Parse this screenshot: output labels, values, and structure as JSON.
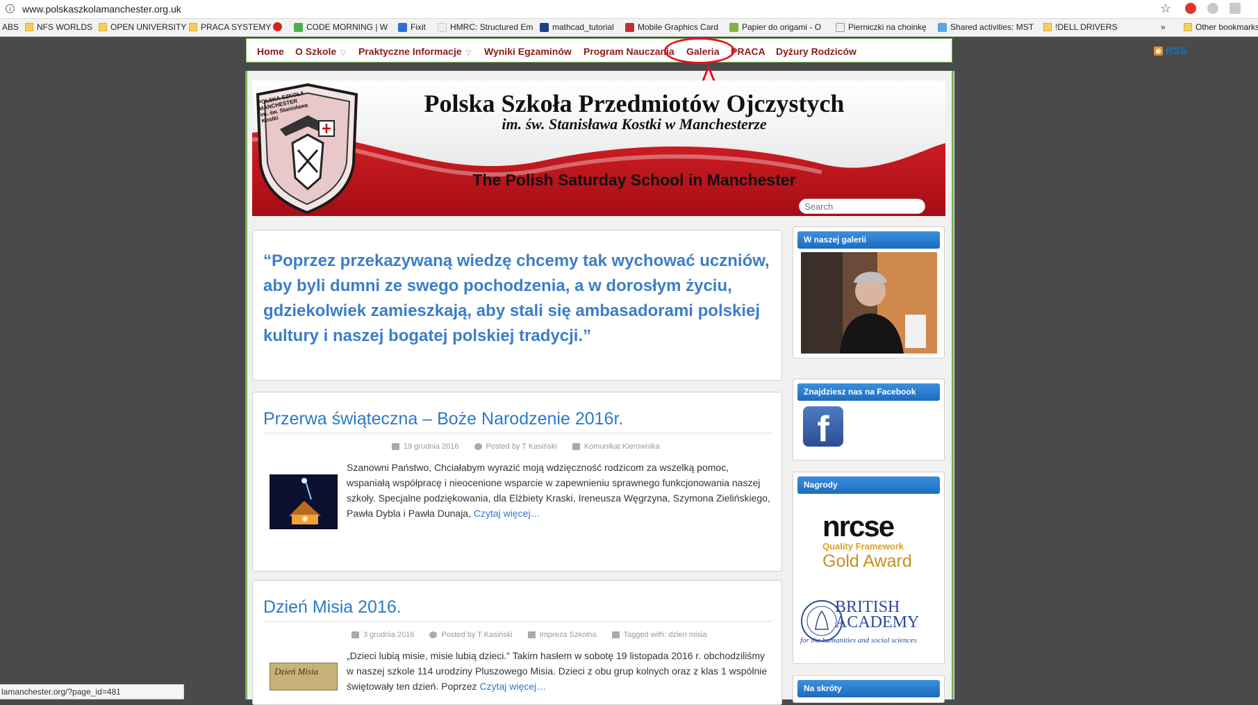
{
  "browser": {
    "url": "www.polskaszkolamanchester.org.uk",
    "bookmarks": [
      {
        "label": "ABS",
        "kind": "none"
      },
      {
        "label": "NFS WORLDS",
        "kind": "folder"
      },
      {
        "label": "OPEN UNIVERSITY",
        "kind": "folder"
      },
      {
        "label": "PRACA SYSTEMY",
        "kind": "folder"
      },
      {
        "label": "",
        "kind": "opera"
      },
      {
        "label": "CODE MORNING | W",
        "kind": "page"
      },
      {
        "label": "Fixit",
        "kind": "page"
      },
      {
        "label": "HMRC: Structured Em",
        "kind": "page"
      },
      {
        "label": "mathcad_tutorial",
        "kind": "page"
      },
      {
        "label": "Mobile Graphics Card",
        "kind": "page"
      },
      {
        "label": "Papier do origami - O",
        "kind": "page"
      },
      {
        "label": "Pierniczki na choinkę",
        "kind": "page"
      },
      {
        "label": "Shared activities: MST",
        "kind": "page"
      },
      {
        "label": "!DELL DRIVERS",
        "kind": "folder"
      }
    ],
    "bookmarks_overflow": "»",
    "other_bookmarks": "Other bookmarks",
    "status_url": "lamanchester.org/?page_id=481"
  },
  "nav": {
    "items": [
      {
        "label": "Home",
        "dropdown": false
      },
      {
        "label": "O Szkole",
        "dropdown": true
      },
      {
        "label": "Praktyczne Informacje",
        "dropdown": true
      },
      {
        "label": "Wyniki Egzaminów",
        "dropdown": false
      },
      {
        "label": "Program Nauczania",
        "dropdown": false
      },
      {
        "label": "Galeria",
        "dropdown": false
      },
      {
        "label": "PRACA",
        "dropdown": false
      },
      {
        "label": "Dyżury Rodziców",
        "dropdown": false
      }
    ],
    "rss": "RSS"
  },
  "banner": {
    "title": "Polska Szkoła Przedmiotów Ojczystych",
    "subtitle": "im. św. Stanisława Kostki w Manchesterze",
    "english": "The Polish Saturday School in Manchester",
    "crest_text": "POLSKA SZKOŁA MANCHESTER im. św. Stanisława Kostki"
  },
  "search": {
    "placeholder": "Search"
  },
  "quote": {
    "text": "“Poprzez przekazywaną wiedzę chcemy tak wychować uczniów, aby byli dumni ze swego pochodzenia, a w dorosłym życiu, gdziekolwiek zamieszkają, aby stali się ambasadorami polskiej kultury i naszej bogatej polskiej tradycji.”"
  },
  "posts": [
    {
      "title": "Przerwa świąteczna – Boże Narodzenie 2016r.",
      "date": "19 grudnia 2016",
      "author": "Posted by T Kasiński",
      "category": "Komunikat Kierownika",
      "tags": "",
      "excerpt": "Szanowni Państwo, Chciałabym wyrazić moją wdzięczność rodzicom za wszelką pomoc, wspaniałą współpracę i nieocenione wsparcie w zapewnieniu sprawnego funkcjonowania naszej szkoły. Specjalne podziękowania, dla Elżbiety Kraski, Ireneusza Węgrzyna, Szymona Zielińskiego, Pawła Dybla i Pawła Dunaja,",
      "more": "Czytaj więcej…"
    },
    {
      "title": "Dzień Misia 2016.",
      "date": "3 grudnia 2016",
      "author": "Posted by T Kasiński",
      "category": "Impreza Szkolna",
      "tags": "Tagged with: dzien misia",
      "excerpt": "„Dzieci lubią misie, misie lubią dzieci.”   Takim hasłem w sobotę 19 listopada 2016 r. obchodziliśmy w naszej szkole 114 urodziny Pluszowego Misia. Dzieci z obu grup kolnych oraz z klas 1 wspólnie świętowały ten dzień. Poprzez",
      "more": "Czytaj więcej…",
      "thumb_text": "Dzień Misia"
    }
  ],
  "sidebar": {
    "gallery_title": "W naszej galerii",
    "facebook_title": "Znajdziesz nas na Facebook",
    "awards_title": "Nagrody",
    "nrcse_logo": "nrcse",
    "nrcse_line1": "Quality Framework",
    "nrcse_line2": "Gold Award",
    "british_academy_1": "BRITISH",
    "british_academy_2": "ACADEMY",
    "british_academy_3": "for the humanities and social sciences",
    "shortcuts_title": "Na skróty"
  },
  "colors": {
    "nav_text": "#8b1a1a",
    "link_blue": "#2d79c7",
    "frame_green": "#78b753",
    "highlight_red": "#e3141e"
  }
}
